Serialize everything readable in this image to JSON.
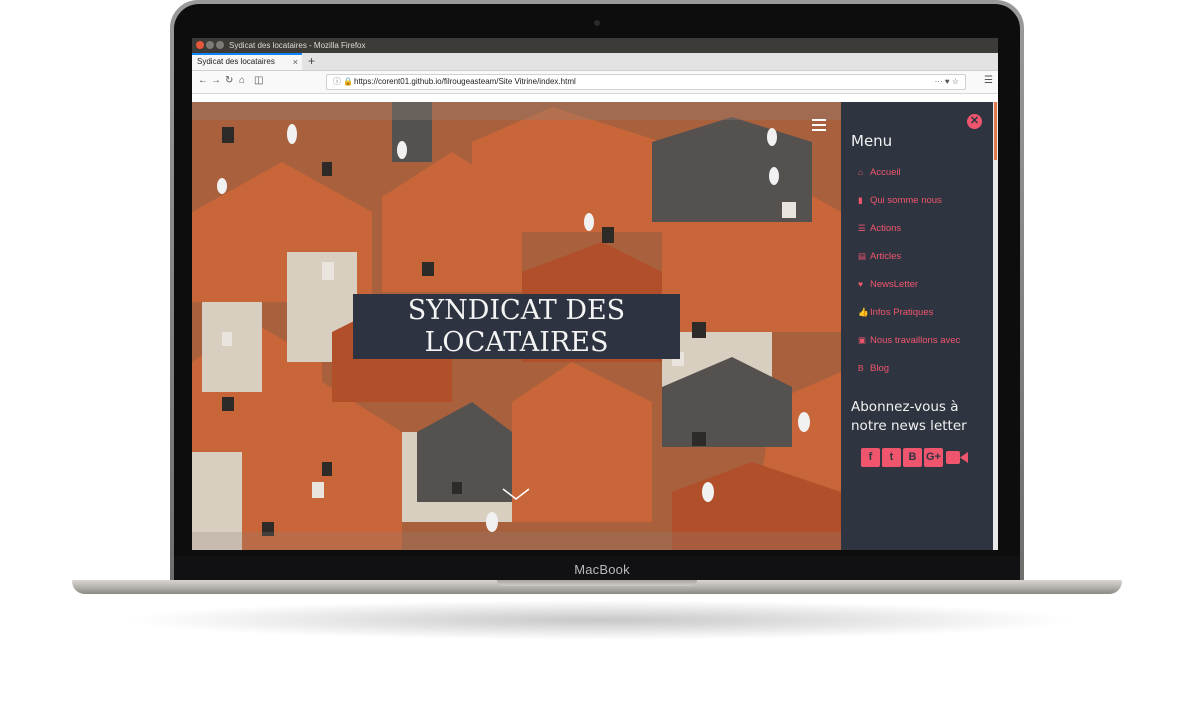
{
  "device": {
    "brand": "MacBook"
  },
  "window": {
    "title": "Sydicat des locataires - Mozilla Firefox"
  },
  "browser": {
    "tab_title": "Sydicat des locataires",
    "tab_close": "×",
    "new_tab": "+",
    "url": "https://corent01.github.io/filrougeasteam/Site Vitrine/index.html",
    "url_actions": "··· ♥ ☆"
  },
  "hero": {
    "title": "SYNDICAT DES\nLOCATAIRES"
  },
  "sidebar": {
    "close_glyph": "✕",
    "heading": "Menu",
    "items": [
      {
        "icon": "home-icon",
        "glyph": "⌂",
        "label": "Accueil"
      },
      {
        "icon": "bookmark-icon",
        "glyph": "▮",
        "label": "Qui somme nous"
      },
      {
        "icon": "list-icon",
        "glyph": "☰",
        "label": "Actions"
      },
      {
        "icon": "newspaper-icon",
        "glyph": "▤",
        "label": "Articles"
      },
      {
        "icon": "heart-icon",
        "glyph": "♥",
        "label": "NewsLetter"
      },
      {
        "icon": "thumbs-up-icon",
        "glyph": "👍",
        "label": "Infos Pratiques"
      },
      {
        "icon": "handshake-icon",
        "glyph": "▣",
        "label": "Nous travaillons avec"
      },
      {
        "icon": "blogger-icon",
        "glyph": "B",
        "label": "Blog"
      }
    ],
    "newsletter_heading": "Abonnez-vous à notre news letter",
    "social": [
      {
        "icon": "facebook-icon",
        "glyph": "f"
      },
      {
        "icon": "twitter-icon",
        "glyph": "t"
      },
      {
        "icon": "blogger-icon",
        "glyph": "B"
      },
      {
        "icon": "google-plus-icon",
        "glyph": "G+"
      },
      {
        "icon": "video-icon",
        "glyph": ""
      }
    ]
  },
  "colors": {
    "sidebar_bg": "#2f3540",
    "accent": "#f0556e",
    "hero_box": "#2d3340",
    "roof": "#c0653b"
  }
}
